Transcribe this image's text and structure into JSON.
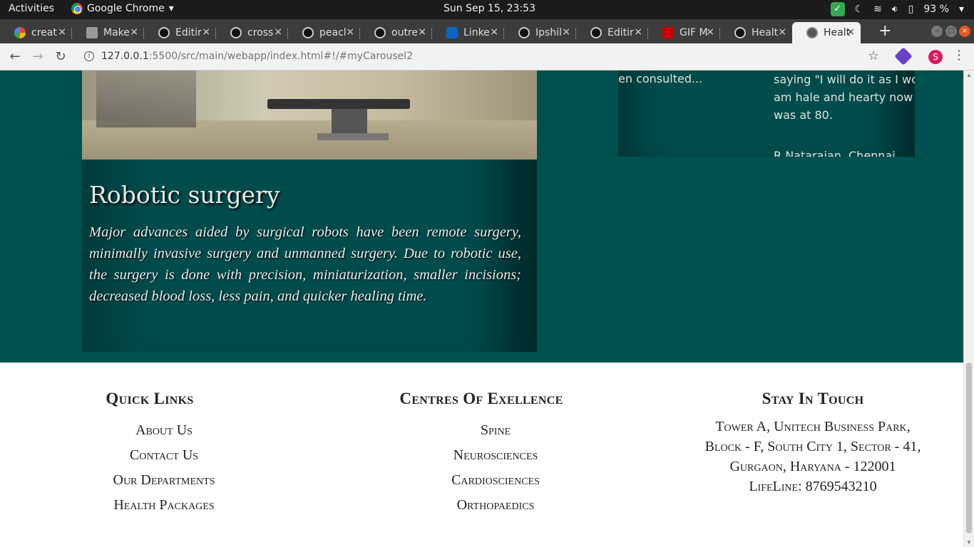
{
  "system_bar": {
    "activities": "Activities",
    "app_name": "Google Chrome",
    "clock": "Sun Sep 15, 23:53",
    "battery": "93 %"
  },
  "tabs": [
    {
      "label": "creat",
      "icon": "google-icon"
    },
    {
      "label": "Make",
      "icon": "document-icon"
    },
    {
      "label": "Editir",
      "icon": "github-icon"
    },
    {
      "label": "cross",
      "icon": "github-icon"
    },
    {
      "label": "peacl",
      "icon": "github-icon"
    },
    {
      "label": "outre",
      "icon": "github-icon"
    },
    {
      "label": "Linke",
      "icon": "linkedin-icon"
    },
    {
      "label": "Ipshil",
      "icon": "github-icon"
    },
    {
      "label": "Editir",
      "icon": "github-icon"
    },
    {
      "label": "GIF M",
      "icon": "gif-maker-icon"
    },
    {
      "label": "Healt",
      "icon": "github-icon"
    },
    {
      "label": "Healt",
      "icon": "globe-icon",
      "active": true
    }
  ],
  "address_bar": {
    "host": "127.0.0.1",
    "path": ":5500/src/main/webapp/index.html#!/#myCarousel2"
  },
  "profile_initial": "S",
  "carousel_card": {
    "title": "Robotic surgery",
    "text": "Major advances aided by surgical robots have been remote surgery, minimally invasive surgery and unmanned surgery. Due to robotic use, the surgery is done with precision, miniaturization, smaller incisions; decreased blood loss, less pain, and quicker healing time."
  },
  "testimonial": {
    "left_fragment": "en consulted...",
    "right_lines": [
      "saying \"I will do it as I wo",
      "am hale and hearty now",
      "was at 80."
    ],
    "author": "R Natarajan, Chennai"
  },
  "footer": {
    "quick_links": {
      "heading": "Quick Links",
      "items": [
        "About Us",
        "Contact Us",
        "Our Departments",
        "Health Packages"
      ]
    },
    "centres": {
      "heading": "Centres Of Exellence",
      "items": [
        "Spine",
        "Neurosciences",
        "Cardiosciences",
        "Orthopaedics"
      ]
    },
    "contact": {
      "heading": "Stay In Touch",
      "address_lines": [
        "Tower A, Unitech Business Park,",
        "Block - F, South City 1, Sector - 41,",
        "Gurgaon, Haryana - 122001"
      ],
      "lifeline": "LifeLine: 8769543210"
    }
  },
  "colors": {
    "teal_bg": "#005050",
    "card_bg": "#004c4c",
    "tab_strip": "#3c3c3c",
    "close_button": "#e95420"
  }
}
